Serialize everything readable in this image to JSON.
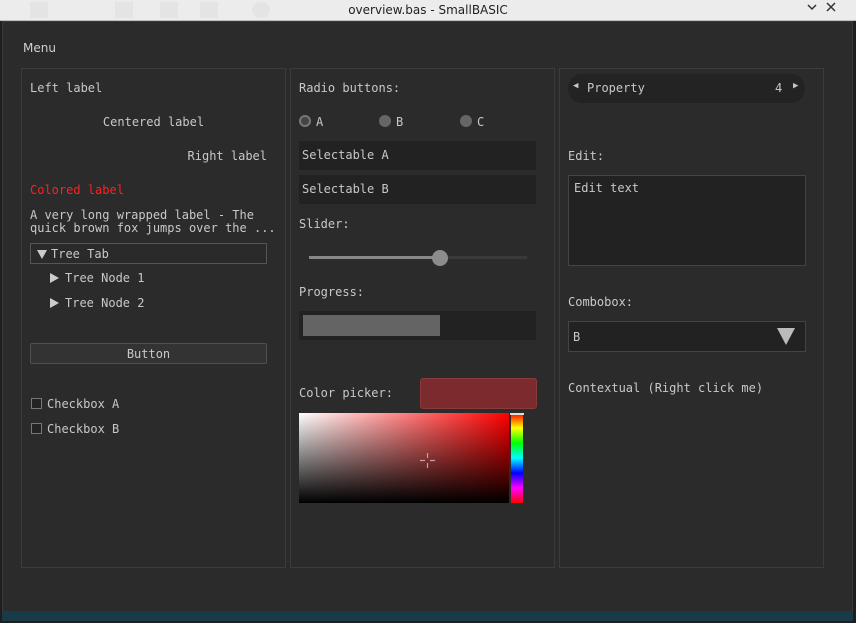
{
  "window": {
    "title": "overview.bas - SmallBASIC",
    "min_icon": "chevron-down-icon",
    "close_icon": "close-icon"
  },
  "menu": {
    "label": "Menu"
  },
  "left": {
    "left_label": "Left label",
    "centered_label": "Centered label",
    "right_label": "Right label",
    "colored_label": "Colored label",
    "colored_color": "#ff2020",
    "wrapped_line1": "A very long wrapped label - The",
    "wrapped_line2": "quick brown fox jumps over the ...",
    "tree_tab": "Tree Tab",
    "tree_nodes": [
      "Tree Node 1",
      "Tree Node 2"
    ],
    "button": "Button",
    "checkboxes": [
      "Checkbox A",
      "Checkbox B"
    ]
  },
  "middle": {
    "radio_heading": "Radio buttons:",
    "radios": [
      "A",
      "B",
      "C"
    ],
    "radio_selected": "A",
    "selectables": [
      "Selectable A",
      "Selectable B"
    ],
    "slider_label": "Slider:",
    "slider_value": 0.6,
    "progress_label": "Progress:",
    "progress_value": 0.6,
    "color_label": "Color picker:",
    "picked_color": "#7b2b2e"
  },
  "right": {
    "property_label": "Property",
    "property_value": "4",
    "edit_label": "Edit:",
    "edit_text": "Edit text",
    "combo_label": "Combobox:",
    "combo_value": "B",
    "contextual": "Contextual (Right click me)"
  }
}
